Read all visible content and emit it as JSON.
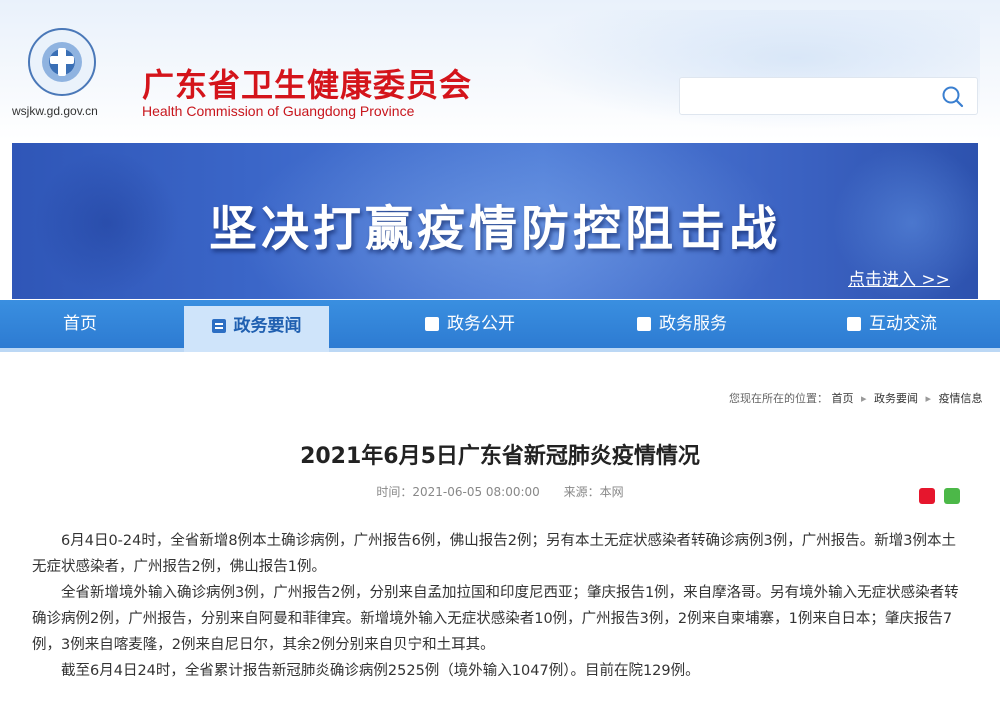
{
  "header": {
    "site_title": "广东省卫生健康委员会",
    "site_subtitle": "Health Commission of Guangdong Province",
    "domain": "wsjkw.gd.gov.cn",
    "search_value": "",
    "brand_color": "#d4141b"
  },
  "banner": {
    "slogan": "坚决打赢疫情防控阻击战",
    "enter_link": "点击进入 >>"
  },
  "nav": {
    "items": [
      {
        "label": "首页"
      },
      {
        "label": "政务要闻"
      },
      {
        "label": "政务公开"
      },
      {
        "label": "政务服务"
      },
      {
        "label": "互动交流"
      }
    ],
    "active_index": 1,
    "color": "#2d7bd2"
  },
  "breadcrumb": {
    "prefix": "您现在所在的位置：",
    "items": [
      "首页",
      "政务要闻",
      "疫情信息"
    ]
  },
  "article": {
    "title": "2021年6月5日广东省新冠肺炎疫情情况",
    "time": "时间：2021-06-05 08:00:00",
    "source": "来源：本网",
    "paragraphs": [
      "6月4日0-24时，全省新增8例本土确诊病例，广州报告6例，佛山报告2例；另有本土无症状感染者转确诊病例3例，广州报告。新增3例本土无症状感染者，广州报告2例，佛山报告1例。",
      "全省新增境外输入确诊病例3例，广州报告2例，分别来自孟加拉国和印度尼西亚；肇庆报告1例，来自摩洛哥。另有境外输入无症状感染者转确诊病例2例，广州报告，分别来自阿曼和菲律宾。新增境外输入无症状感染者10例，广州报告3例，2例来自柬埔寨，1例来自日本；肇庆报告7例，3例来自喀麦隆，2例来自尼日尔，其余2例分别来自贝宁和土耳其。",
      "截至6月4日24时，全省累计报告新冠肺炎确诊病例2525例（境外输入1047例）。目前在院129例。"
    ]
  },
  "share": {
    "icons": [
      "weibo-icon",
      "wechat-icon"
    ]
  }
}
